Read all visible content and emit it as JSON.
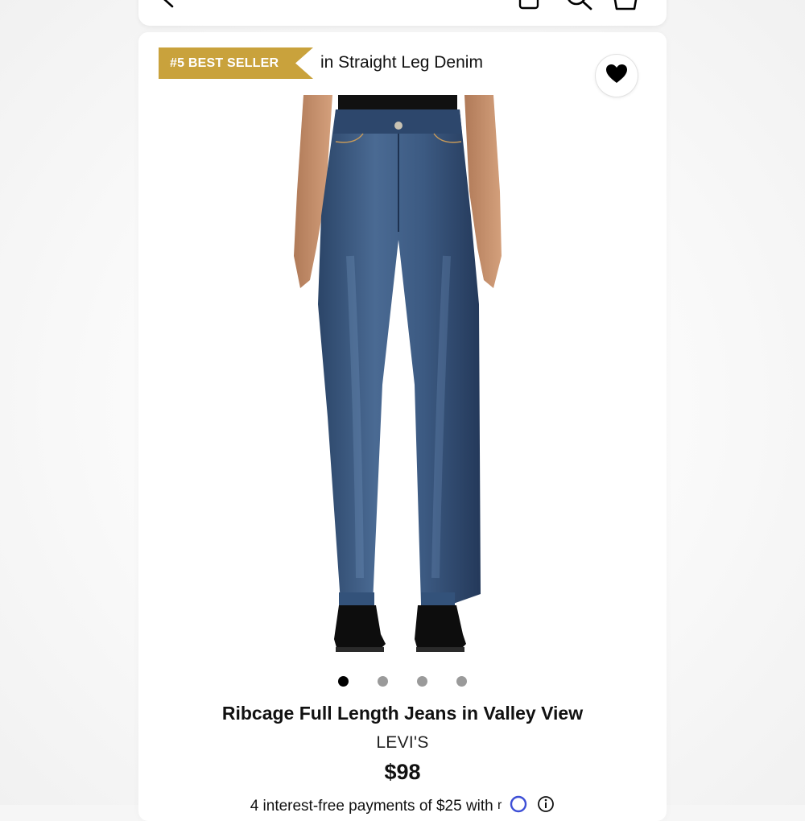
{
  "header": {
    "icons": [
      "back-icon",
      "bag-small-icon",
      "search-icon",
      "cart-icon"
    ]
  },
  "badge": {
    "rank_label": "#5 BEST SELLER",
    "category": "in Straight Leg Denim",
    "color": "#c9a23c"
  },
  "wishlist": {
    "icon": "heart-icon"
  },
  "carousel": {
    "total": 4,
    "active_index": 0
  },
  "product": {
    "title": "Ribcage Full Length Jeans in Valley View",
    "brand": "LEVI'S",
    "price": "$98"
  },
  "payment": {
    "text": "4 interest-free payments of $25 with",
    "icons": [
      "afterpay-icon",
      "info-icon"
    ]
  }
}
